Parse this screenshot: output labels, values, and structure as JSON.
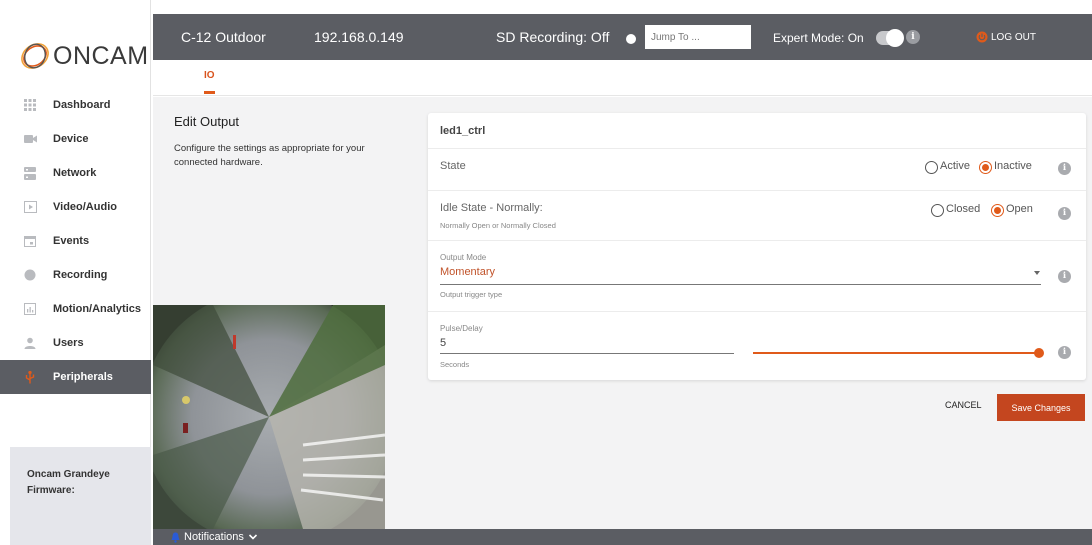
{
  "brand": {
    "logo_text": "ONCAM",
    "accent": "#e05a1a"
  },
  "sidebar": {
    "items": [
      {
        "label": "Dashboard",
        "icon": "grid-icon"
      },
      {
        "label": "Device",
        "icon": "camera-icon"
      },
      {
        "label": "Network",
        "icon": "server-icon"
      },
      {
        "label": "Video/Audio",
        "icon": "play-icon"
      },
      {
        "label": "Events",
        "icon": "calendar-icon"
      },
      {
        "label": "Recording",
        "icon": "record-icon"
      },
      {
        "label": "Motion/Analytics",
        "icon": "analytics-icon"
      },
      {
        "label": "Users",
        "icon": "user-icon"
      },
      {
        "label": "Peripherals",
        "icon": "usb-icon",
        "active": true
      }
    ],
    "firmware_line1": "Oncam Grandeye",
    "firmware_line2": "Firmware:"
  },
  "topbar": {
    "device_name": "C-12 Outdoor",
    "ip": "192.168.0.149",
    "sd_recording": "SD Recording: Off",
    "jump_placeholder": "Jump To ...",
    "expert_mode": "Expert Mode: On",
    "logout": "LOG OUT"
  },
  "tabs": {
    "io": "IO"
  },
  "edit": {
    "title": "Edit Output",
    "description": "Configure the settings as appropriate for your connected hardware."
  },
  "card": {
    "name": "led1_ctrl",
    "state": {
      "label": "State",
      "options": [
        "Active",
        "Inactive"
      ],
      "selected": "Inactive"
    },
    "idle_state": {
      "label": "Idle State - Normally:",
      "hint": "Normally Open or Normally Closed",
      "options": [
        "Closed",
        "Open"
      ],
      "selected": "Open"
    },
    "output_mode": {
      "label": "Output Mode",
      "value": "Momentary",
      "hint": "Output trigger type"
    },
    "pulse": {
      "label": "Pulse/Delay",
      "value": "5",
      "unit": "Seconds",
      "slider_fraction": 1.0
    }
  },
  "actions": {
    "cancel": "CANCEL",
    "save": "Save Changes"
  },
  "footer": {
    "notifications": "Notifications"
  }
}
